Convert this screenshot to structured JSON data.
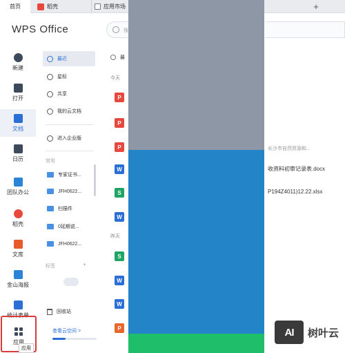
{
  "tabs": {
    "home": "首页",
    "daoke": "稻壳",
    "market": "应用市场",
    "new_tab": "+"
  },
  "header": {
    "logo": "WPS Office",
    "search_placeholder": "搜"
  },
  "nav": [
    {
      "label": "新建",
      "icon": "plus-circle-icon"
    },
    {
      "label": "打开",
      "icon": "folder-open-icon"
    },
    {
      "label": "文档",
      "icon": "document-icon"
    },
    {
      "label": "日历",
      "icon": "calendar-icon"
    },
    {
      "label": "团队办公",
      "icon": "team-icon"
    },
    {
      "label": "稻壳",
      "icon": "daoke-icon"
    },
    {
      "label": "文库",
      "icon": "library-icon"
    },
    {
      "label": "金山海报",
      "icon": "poster-icon"
    },
    {
      "label": "统计表单",
      "icon": "form-icon"
    }
  ],
  "nav_apps": {
    "label": "应用",
    "tooltip": "应用"
  },
  "col2": {
    "recent": "最近",
    "starred": "星标",
    "shared": "共享",
    "my_cloud": "我的云文档",
    "enterprise": "进入企业版",
    "common_head": "常用",
    "common": [
      "专家证书...",
      "JFH0622...",
      "扫描件",
      "0延期说...",
      "JFH0622..."
    ],
    "tags_head": "标签",
    "tags_add": "+",
    "recycle": "回收站",
    "cloud_link": "查看云空间 >"
  },
  "files": {
    "top_label": "最",
    "group_today": "今天",
    "group_yesterday": "昨天",
    "rows_today": [
      {
        "type": "P",
        "cls": "t-pdf",
        "name": ""
      },
      {
        "type": "P",
        "cls": "t-pdf",
        "name": ""
      },
      {
        "type": "P",
        "cls": "t-pdf",
        "name": "长沙市自然资源和..."
      },
      {
        "type": "W",
        "cls": "t-doc",
        "name": "收资料初审记录表.docx"
      },
      {
        "type": "S",
        "cls": "t-xls",
        "name": "P194Z4011)12.22.xlsx"
      },
      {
        "type": "W",
        "cls": "t-doc",
        "name": ""
      }
    ],
    "rows_yesterday": [
      {
        "type": "S",
        "cls": "t-xls",
        "name": ""
      },
      {
        "type": "W",
        "cls": "t-doc",
        "name": ""
      },
      {
        "type": "W",
        "cls": "t-doc",
        "name": ""
      },
      {
        "type": "P",
        "cls": "t-ppt",
        "name": ""
      }
    ]
  },
  "watermark": {
    "box": "AI",
    "text": "树叶云"
  }
}
